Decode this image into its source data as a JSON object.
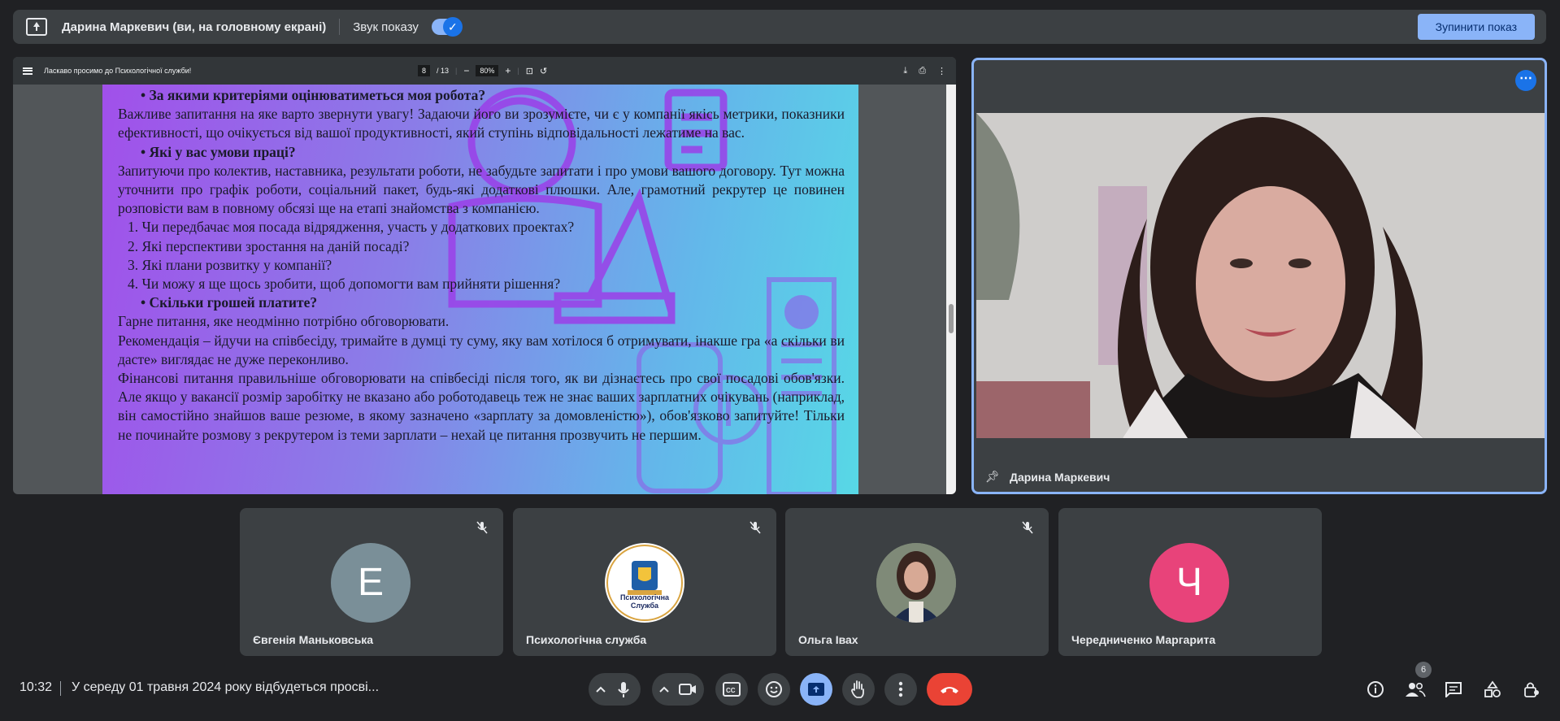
{
  "presenting_bar": {
    "title": "Дарина Маркевич (ви, на головному екрані)",
    "sound_label": "Звук показу",
    "sound_on": true,
    "stop_button": "Зупинити показ"
  },
  "pdf_viewer": {
    "doc_title": "Ласкаво просимо до Психологічної служби!",
    "page_current": "8",
    "page_total": "/ 13",
    "zoom": "80%",
    "lines": [
      {
        "type": "bullet",
        "text": "• За якими критеріями оцінюватиметься моя робота?"
      },
      {
        "type": "para",
        "text": "Важливе запитання на яке варто звернути увагу! Задаючи його ви зрозумієте, чи є у компанії якісь метрики, показники ефективності, що очікується від вашої продуктивності, який ступінь відповідальності лежатиме на вас."
      },
      {
        "type": "bullet",
        "text": "• Які у вас умови праці?"
      },
      {
        "type": "para",
        "text": "Запитуючи про колектив, наставника, результати роботи, не забудьте запитати і про умови вашого договору. Тут можна уточнити про графік роботи, соціальний пакет, будь-які додаткові плюшки. Але, грамотний рекрутер це повинен розповісти вам в повному обсязі ще на етапі знайомства з компанією."
      },
      {
        "type": "num",
        "text": "1. Чи передбачає моя посада відрядження, участь у додаткових проектах?"
      },
      {
        "type": "num",
        "text": "2. Які перспективи зростання на даній посаді?"
      },
      {
        "type": "num",
        "text": "3. Які плани розвитку у компанії?"
      },
      {
        "type": "num",
        "text": "4. Чи можу я ще щось зробити, щоб допомогти вам прийняти рішення?"
      },
      {
        "type": "bullet",
        "text": "• Скільки грошей платите?"
      },
      {
        "type": "para",
        "text": "Гарне питання, яке неодмінно потрібно обговорювати."
      },
      {
        "type": "para",
        "text": "Рекомендація – йдучи на співбесіду, тримайте в думці ту суму, яку вам хотілося б отримувати, інакше гра «а скільки ви дасте» виглядає не дуже переконливо."
      },
      {
        "type": "para",
        "text": "Фінансові питання правильніше обговорювати на співбесіді після того, як ви дізнаєтесь про свої посадові обов'язки. Але якщо у вакансії розмір заробітку не вказано або роботодавець теж не знає ваших зарплатних очікувань (наприклад, він самостійно знайшов ваше резюме, в якому зазначено «зарплату за домовленістю»), обов'язково запитуйте! Тільки не починайте розмову з рекрутером із теми зарплати – нехай це питання прозвучить не першим."
      }
    ]
  },
  "speaker": {
    "name": "Дарина Маркевич"
  },
  "participants": [
    {
      "name": "Євгенія Маньковська",
      "initial": "Е",
      "color": "#7a8f98",
      "muted": true
    },
    {
      "name": "Психологічна служба",
      "initial": "",
      "color": "#ffffff",
      "muted": true,
      "logo_text": "Психологічна Служба"
    },
    {
      "name": "Ольга Івах",
      "initial": "",
      "color": "#6d7b6a",
      "muted": true
    },
    {
      "name": "Чередниченко Маргарита",
      "initial": "Ч",
      "color": "#e8437a",
      "muted": false
    }
  ],
  "bottom_bar": {
    "time": "10:32",
    "meeting_title": "У середу 01 травня 2024 року відбудеться просві...",
    "participants_count": "6"
  },
  "colors": {
    "accent": "#8ab4f8",
    "end_call": "#ea4335",
    "tile": "#3c4043",
    "background": "#202124"
  }
}
